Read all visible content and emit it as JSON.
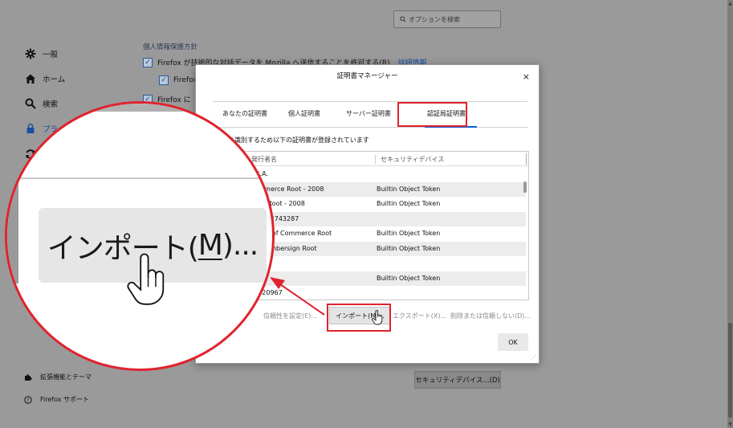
{
  "search": {
    "placeholder": "オプションを検索"
  },
  "sidebar": {
    "items": [
      {
        "label": "一般",
        "icon": "gear-icon"
      },
      {
        "label": "ホーム",
        "icon": "home-icon"
      },
      {
        "label": "検索",
        "icon": "search-icon"
      },
      {
        "label": "プライバ",
        "icon": "lock-icon"
      },
      {
        "label": "",
        "icon": "sync-icon"
      }
    ],
    "footer": [
      {
        "label": "拡張機能とテーマ",
        "icon": "puzzle-icon"
      },
      {
        "label": "Firefox サポート",
        "icon": "help-icon"
      }
    ]
  },
  "privacy": {
    "section_head": "個人情報保護方針",
    "row1": "Firefox が技術的な対話データを Mozilla へ送信することを許可する(R)",
    "row1_link": "詳細情報",
    "row2": "Firefox",
    "row3": "Firefox に"
  },
  "background_buttons": {
    "security_devices": "セキュリティデバイス...(D)"
  },
  "dialog": {
    "title": "証明書マネージャー",
    "close": "×",
    "tabs": [
      "あなたの証明書",
      "個人証明書",
      "サーバー証明書",
      "認証局証明書"
    ],
    "description": "を識別するため以下の証明書が登録されています",
    "columns": [
      "発行者名",
      "セキュリティデバイス"
    ],
    "rows": [
      {
        "name": "a S.A.",
        "device": ""
      },
      {
        "name": "Commerce Root - 2008",
        "device": "Builtin Object Token"
      },
      {
        "name": "rsign Root - 2008",
        "device": "Builtin Object Token"
      },
      {
        "name": "CIF A82743287",
        "device": ""
      },
      {
        "name": "mbers of Commerce Root",
        "device": "Builtin Object Token"
      },
      {
        "name": "al Chambersign Root",
        "device": "Builtin Object Token"
      },
      {
        "name": "",
        "device": ""
      },
      {
        "name": "",
        "device": "Builtin Object Token"
      },
      {
        "name": "58520967",
        "device": ""
      }
    ],
    "buttons": {
      "trust": "信頼性を設定(E)...",
      "import": "インポート(M)...",
      "export": "エクスポート(X)...",
      "delete": "削除または信頼しない(D)..."
    },
    "ok": "OK"
  },
  "magnifier": {
    "label_prefix": "インポート(",
    "label_key": "M",
    "label_suffix": ")..."
  },
  "colors": {
    "highlight": "#e0232e",
    "accent": "#0a62d6"
  }
}
